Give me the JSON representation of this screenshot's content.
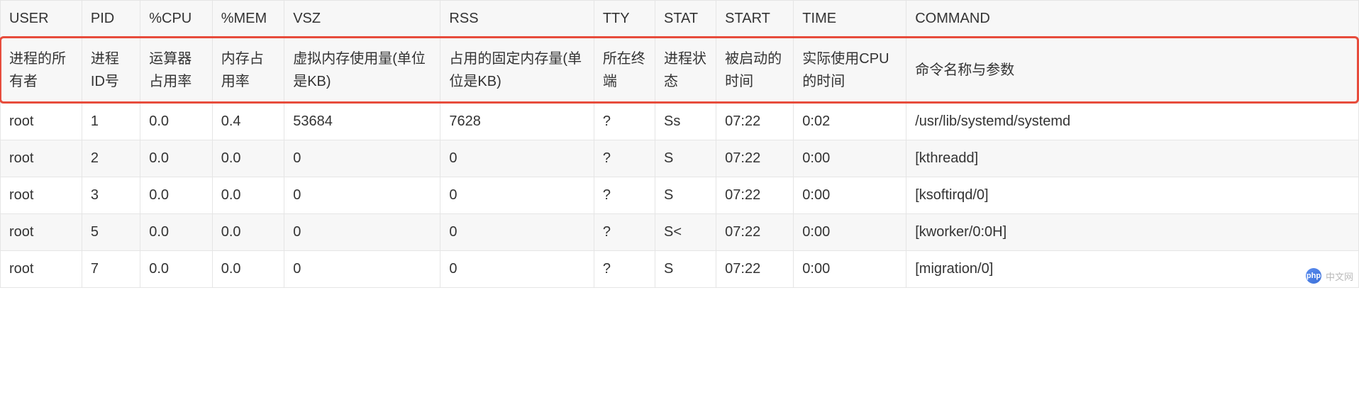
{
  "columns": [
    {
      "key": "user",
      "header": "USER",
      "desc": "进程的所有者"
    },
    {
      "key": "pid",
      "header": "PID",
      "desc": "进程ID号"
    },
    {
      "key": "cpu",
      "header": "%CPU",
      "desc": "运算器占用率"
    },
    {
      "key": "mem",
      "header": "%MEM",
      "desc": "内存占用率"
    },
    {
      "key": "vsz",
      "header": "VSZ",
      "desc": "虚拟内存使用量(单位是KB)"
    },
    {
      "key": "rss",
      "header": "RSS",
      "desc": "占用的固定内存量(单位是KB)"
    },
    {
      "key": "tty",
      "header": "TTY",
      "desc": "所在终端"
    },
    {
      "key": "stat",
      "header": "STAT",
      "desc": "进程状态"
    },
    {
      "key": "start",
      "header": "START",
      "desc": "被启动的时间"
    },
    {
      "key": "time",
      "header": "TIME",
      "desc": "实际使用CPU的时间"
    },
    {
      "key": "command",
      "header": "COMMAND",
      "desc": "命令名称与参数"
    }
  ],
  "rows": [
    {
      "user": "root",
      "pid": "1",
      "cpu": "0.0",
      "mem": "0.4",
      "vsz": "53684",
      "rss": "7628",
      "tty": "?",
      "stat": "Ss",
      "start": "07:22",
      "time": "0:02",
      "command": "/usr/lib/systemd/systemd"
    },
    {
      "user": "root",
      "pid": "2",
      "cpu": "0.0",
      "mem": "0.0",
      "vsz": "0",
      "rss": "0",
      "tty": "?",
      "stat": "S",
      "start": "07:22",
      "time": "0:00",
      "command": "[kthreadd]"
    },
    {
      "user": "root",
      "pid": "3",
      "cpu": "0.0",
      "mem": "0.0",
      "vsz": "0",
      "rss": "0",
      "tty": "?",
      "stat": "S",
      "start": "07:22",
      "time": "0:00",
      "command": "[ksoftirqd/0]"
    },
    {
      "user": "root",
      "pid": "5",
      "cpu": "0.0",
      "mem": "0.0",
      "vsz": "0",
      "rss": "0",
      "tty": "?",
      "stat": "S<",
      "start": "07:22",
      "time": "0:00",
      "command": "[kworker/0:0H]"
    },
    {
      "user": "root",
      "pid": "7",
      "cpu": "0.0",
      "mem": "0.0",
      "vsz": "0",
      "rss": "0",
      "tty": "?",
      "stat": "S",
      "start": "07:22",
      "time": "0:00",
      "command": "[migration/0]"
    }
  ],
  "watermark": {
    "logo_text": "php",
    "text": "中文网"
  }
}
